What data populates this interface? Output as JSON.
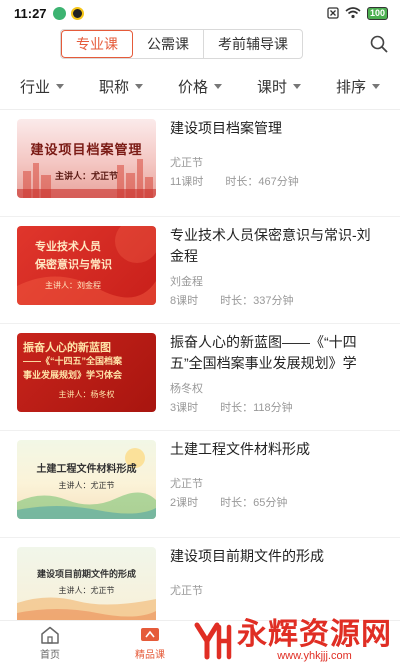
{
  "status": {
    "time": "11:27",
    "battery": "100"
  },
  "tabs": [
    {
      "label": "专业课"
    },
    {
      "label": "公需课"
    },
    {
      "label": "考前辅导课"
    }
  ],
  "filters": [
    {
      "label": "行业"
    },
    {
      "label": "职称"
    },
    {
      "label": "价格"
    },
    {
      "label": "课时"
    },
    {
      "label": "排序"
    }
  ],
  "courses": [
    {
      "title": "建设项目档案管理",
      "lecturer": "尤正节",
      "hours": "11课时",
      "duration": "时长：467分钟",
      "thumb_title": "建设项目档案管理",
      "thumb_lecturer": "主讲人：尤正节"
    },
    {
      "title": "专业技术人员保密意识与常识-刘金程",
      "lecturer": "刘金程",
      "hours": "8课时",
      "duration": "时长：337分钟",
      "thumb_title_1": "专业技术人员",
      "thumb_title_2": "保密意识与常识",
      "thumb_lecturer": "主讲人：刘金程"
    },
    {
      "title": "振奋人心的新蓝图——《“十四五”全国档案事业发展规划》学习…",
      "lecturer": "杨冬权",
      "hours": "3课时",
      "duration": "时长：118分钟",
      "thumb_title_1": "振奋人心的新蓝图",
      "thumb_title_2": "——《“十四五”全国档案",
      "thumb_title_3": "事业发展规划》学习体会",
      "thumb_lecturer": "主讲人：杨冬权"
    },
    {
      "title": "土建工程文件材料形成",
      "lecturer": "尤正节",
      "hours": "2课时",
      "duration": "时长：65分钟",
      "thumb_title": "土建工程文件材料形成",
      "thumb_lecturer": "主讲人：尤正节"
    },
    {
      "title": "建设项目前期文件的形成",
      "lecturer": "尤正节",
      "hours": "",
      "duration": "",
      "thumb_title": "建设项目前期文件的形成",
      "thumb_lecturer": "主讲人：尤正节"
    }
  ],
  "nav": {
    "home": "首页",
    "courses": "精品课"
  },
  "watermark": {
    "text": "永辉资源网",
    "url": "www.yhkjjj.com"
  },
  "colors": {
    "accent": "#e55b3a",
    "thumb_red": "#d9322a"
  }
}
